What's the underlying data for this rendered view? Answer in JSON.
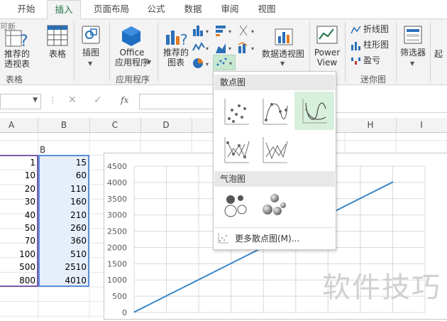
{
  "tabs": [
    {
      "label": "开始",
      "active": false
    },
    {
      "label": "插入",
      "active": true
    },
    {
      "label": "页面布局",
      "active": false
    },
    {
      "label": "公式",
      "active": false
    },
    {
      "label": "数据",
      "active": false
    },
    {
      "label": "审阅",
      "active": false
    },
    {
      "label": "视图",
      "active": false
    }
  ],
  "ribbon": {
    "pivot_label_1": "推荐的",
    "pivot_label_2": "透视表",
    "table_label": "表格",
    "group_table": "表格",
    "illustration_label": "插图",
    "office_label_1": "Office",
    "office_label_2": "应用程序",
    "group_apps": "应用程序",
    "rec_chart_1": "推荐的",
    "rec_chart_2": "图表",
    "pivotchart_label": "数据透视图",
    "powerview_1": "Power",
    "powerview_2": "View",
    "spark_line": "折线图",
    "spark_column": "柱形图",
    "spark_winloss": "盈亏",
    "group_sparkline": "迷你图",
    "filter_label": "筛选器",
    "partial_left": "可新",
    "partial_right": "起"
  },
  "formula_bar": {
    "fx": "fx"
  },
  "columns": [
    "A",
    "B",
    "C",
    "D",
    "H",
    "I"
  ],
  "table": {
    "header_b": "B",
    "rows": [
      {
        "a": "1",
        "b": "15"
      },
      {
        "a": "10",
        "b": "60"
      },
      {
        "a": "20",
        "b": "110"
      },
      {
        "a": "30",
        "b": "160"
      },
      {
        "a": "40",
        "b": "210"
      },
      {
        "a": "50",
        "b": "260"
      },
      {
        "a": "70",
        "b": "360"
      },
      {
        "a": "100",
        "b": "510"
      },
      {
        "a": "500",
        "b": "2510"
      },
      {
        "a": "800",
        "b": "4010"
      }
    ]
  },
  "chart_data": {
    "type": "scatter",
    "x": [
      1,
      10,
      20,
      30,
      40,
      50,
      70,
      100,
      500,
      800
    ],
    "y": [
      15,
      60,
      110,
      160,
      210,
      260,
      360,
      510,
      2510,
      4010
    ],
    "yticks": [
      "4500",
      "4000",
      "3500",
      "3000",
      "2500",
      "2000",
      "1500",
      "1000",
      "500",
      "0"
    ],
    "ylim": [
      0,
      4500
    ],
    "xlim": [
      0,
      900
    ],
    "grid": true,
    "line_color": "#3c87c8"
  },
  "dropdown": {
    "scatter_header": "散点图",
    "bubble_header": "气泡图",
    "more_label": "更多散点图(M)..."
  },
  "watermark": "软件技巧",
  "colors": {
    "accent": "#217346",
    "selected_tile": "#d6f0dc"
  }
}
